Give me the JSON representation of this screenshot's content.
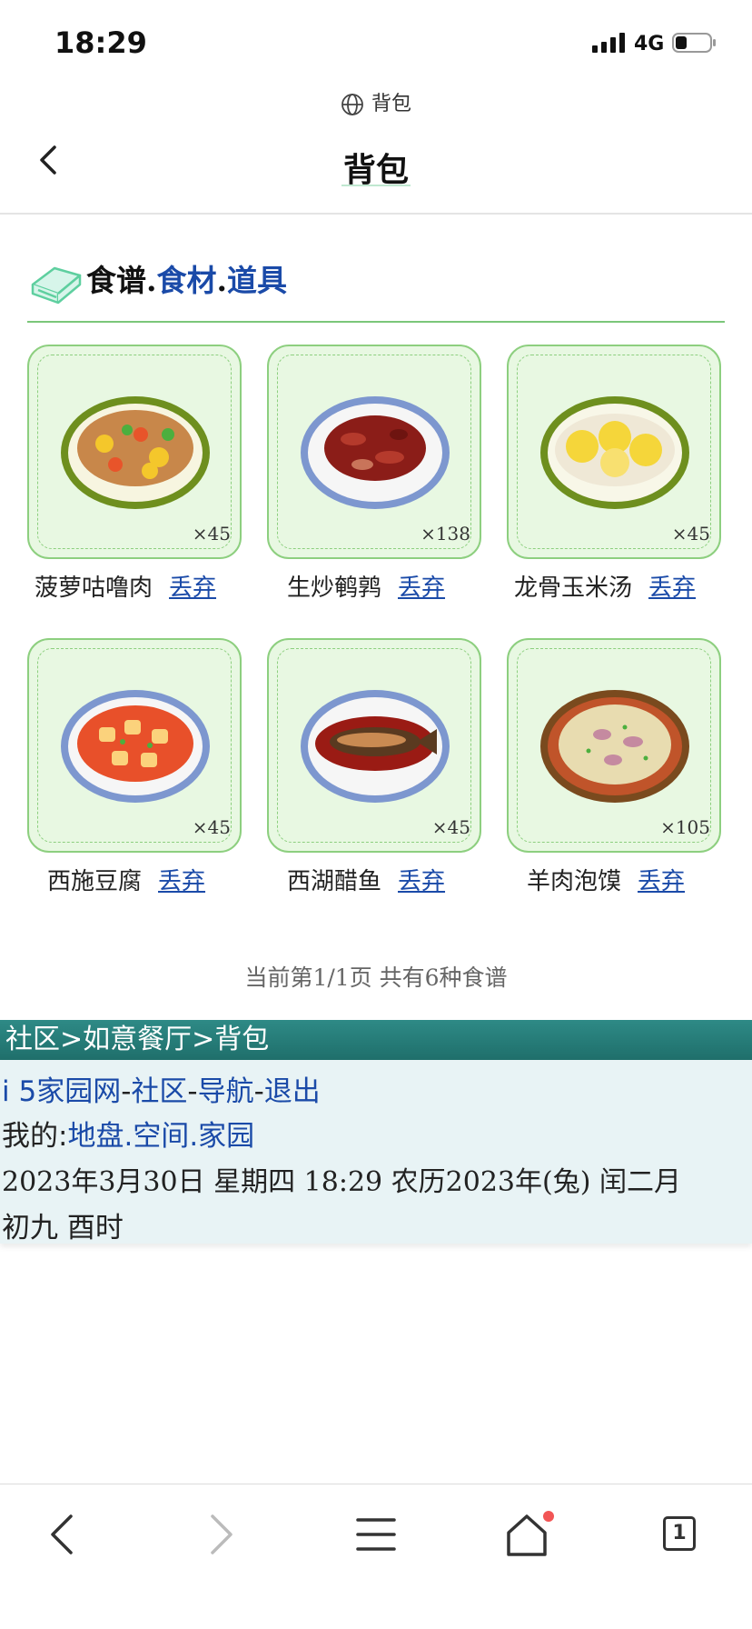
{
  "status_bar": {
    "time": "18:29",
    "network": "4G"
  },
  "browser": {
    "site_label": "背包",
    "page_title": "背包"
  },
  "section": {
    "heading_part1": "食谱",
    "sep1": ".",
    "heading_part2": "食材",
    "sep2": ".",
    "heading_part3": "道具"
  },
  "recipes": [
    {
      "name": "菠萝咕噜肉",
      "qty": "×45",
      "action": "丢弃"
    },
    {
      "name": "生炒鹌鹑",
      "qty": "×138",
      "action": "丢弃"
    },
    {
      "name": "龙骨玉米汤",
      "qty": "×45",
      "action": "丢弃"
    },
    {
      "name": "西施豆腐",
      "qty": "×45",
      "action": "丢弃"
    },
    {
      "name": "西湖醋鱼",
      "qty": "×45",
      "action": "丢弃"
    },
    {
      "name": "羊肉泡馍",
      "qty": "×105",
      "action": "丢弃"
    }
  ],
  "page_info": "当前第1/1页 共有6种食谱",
  "breadcrumb": "社区>如意餐厅>背包",
  "links": {
    "nav_prefix": "i",
    "site": "5家园网",
    "sep": "-",
    "community": "社区",
    "navigation": "导航",
    "logout": "退出"
  },
  "mine": {
    "prefix": "我的:",
    "land": "地盘",
    "dot1": ".",
    "space": "空间",
    "dot2": ".",
    "home": "家园"
  },
  "date_line": "2023年3月30日  星期四  18:29  农历2023年(兔)  闰二月",
  "date_line2": "初九  酉时",
  "bottom_nav": {
    "tab_count": "1"
  },
  "colors": {
    "accent_green": "#8dcf7f",
    "link_blue": "#1a4aa8",
    "teal_bar": "#2e8a86",
    "notify_red": "#f25555"
  }
}
